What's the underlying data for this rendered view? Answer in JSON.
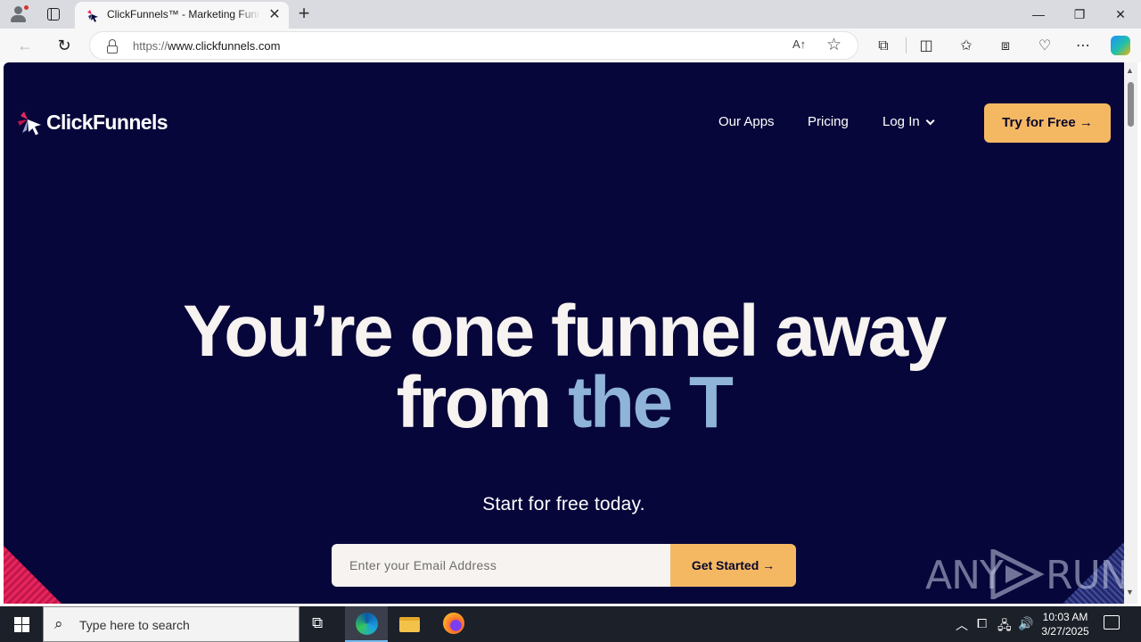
{
  "browser": {
    "tab_title": "ClickFunnels™ - Marketing Funnels",
    "tab_close": "✕",
    "new_tab": "+",
    "url_prefix": "https://",
    "url_host": "www.clickfunnels.com",
    "read_aloud": "A↑",
    "window_controls": {
      "minimize": "—",
      "restore": "❐",
      "close": "✕"
    }
  },
  "page": {
    "logo_text": "ClickFunnels",
    "nav": {
      "our_apps": "Our Apps",
      "pricing": "Pricing",
      "log_in": "Log In",
      "try_free": "Try for Free →"
    },
    "hero_line1": "You’re one funnel away",
    "hero_line2_plain": "from ",
    "hero_line2_accent": "the T",
    "subhero": "Start for free today.",
    "email_placeholder": "Enter your Email Address",
    "get_started": "Get Started →",
    "watermark": "ANY RUN",
    "colors": {
      "background": "#07063a",
      "accent_button": "#f5b862",
      "accent_text": "#8fb4d8"
    }
  },
  "taskbar": {
    "search_placeholder": "Type here to search",
    "time": "10:03 AM",
    "date": "3/27/2025"
  }
}
